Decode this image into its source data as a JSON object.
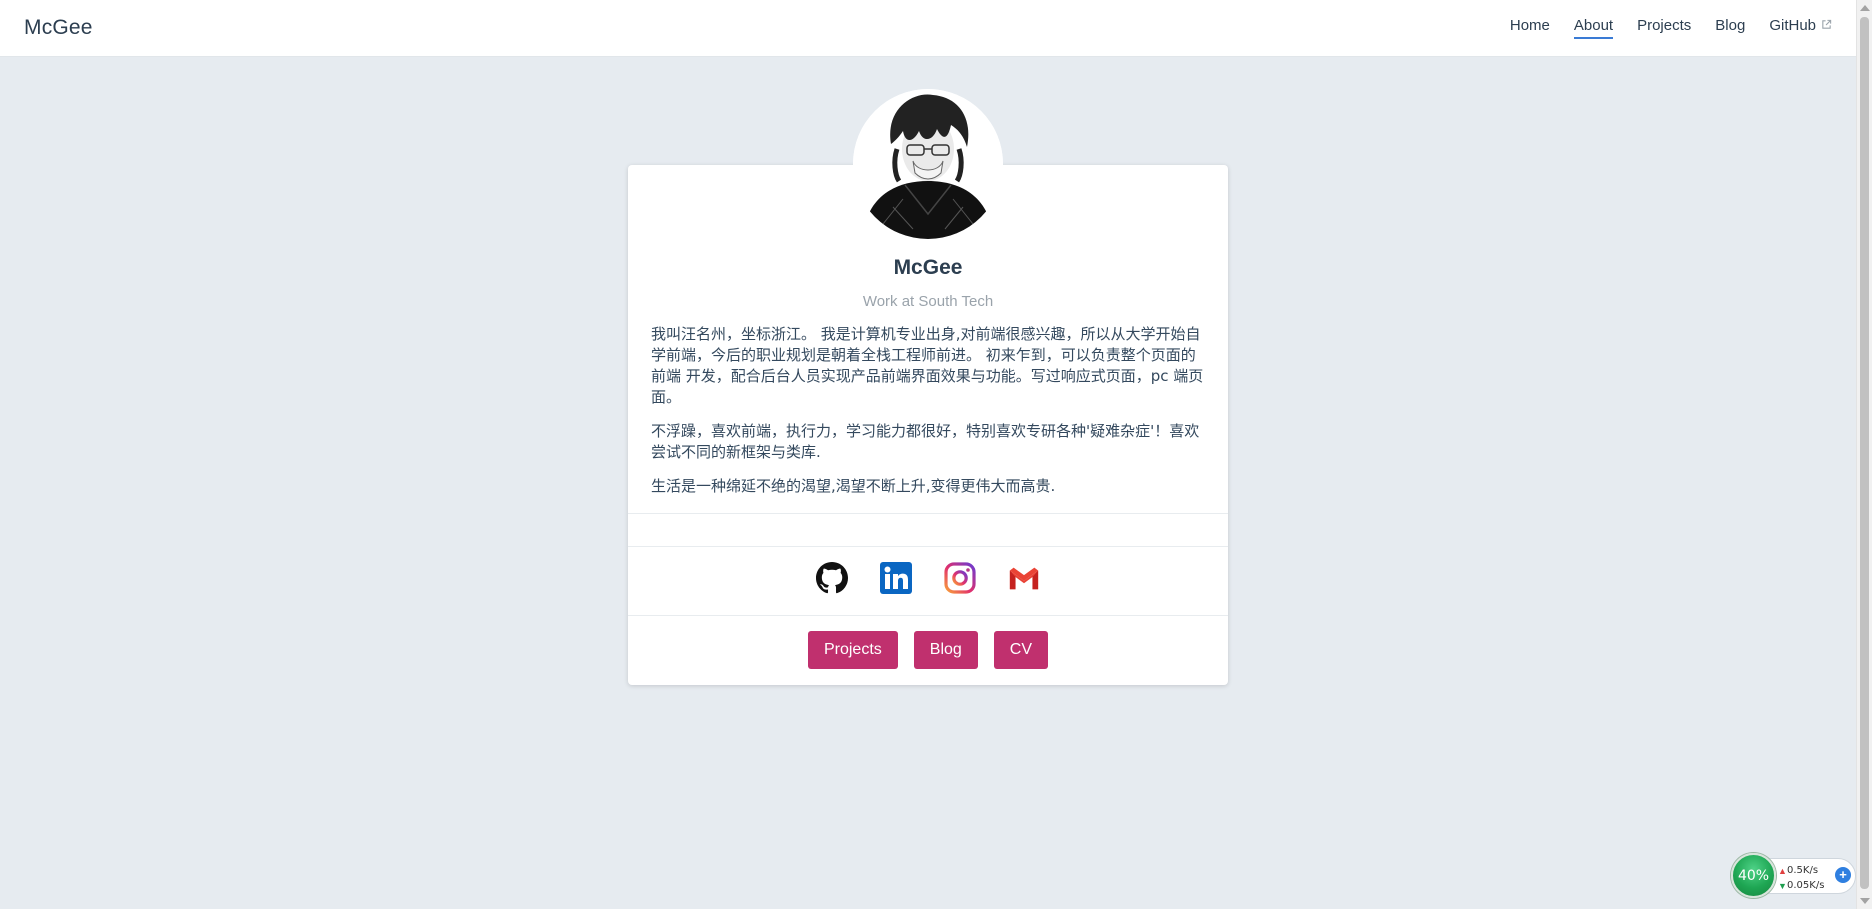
{
  "nav": {
    "brand": "McGee",
    "links": [
      {
        "label": "Home"
      },
      {
        "label": "About"
      },
      {
        "label": "Projects"
      },
      {
        "label": "Blog"
      },
      {
        "label": "GitHub"
      }
    ],
    "active": "About"
  },
  "profile": {
    "name": "McGee",
    "subtitle": "Work at South Tech",
    "bio": [
      "我叫汪名州，坐标浙江。 我是计算机专业出身,对前端很感兴趣，所以从大学开始自学前端，今后的职业规划是朝着全栈工程师前进。 初来乍到，可以负责整个页面的前端 开发，配合后台人员实现产品前端界面效果与功能。写过响应式页面，pc 端页面。",
      "不浮躁，喜欢前端，执行力，学习能力都很好，特别喜欢专研各种'疑难杂症'！喜欢尝试不同的新框架与类库.",
      "生活是一种绵延不绝的渴望,渴望不断上升,变得更伟大而高贵."
    ]
  },
  "social": [
    {
      "icon": "github-icon"
    },
    {
      "icon": "linkedin-icon"
    },
    {
      "icon": "instagram-icon"
    },
    {
      "icon": "gmail-icon"
    }
  ],
  "buttons": {
    "projects": "Projects",
    "blog": "Blog",
    "cv": "CV"
  },
  "colors": {
    "accent_button": "#c0306e",
    "nav_underline": "#3a7bd5",
    "background": "#e6ebf0"
  },
  "network_widget": {
    "percent": "40%",
    "upload": "0.5K/s",
    "download": "0.05K/s"
  }
}
